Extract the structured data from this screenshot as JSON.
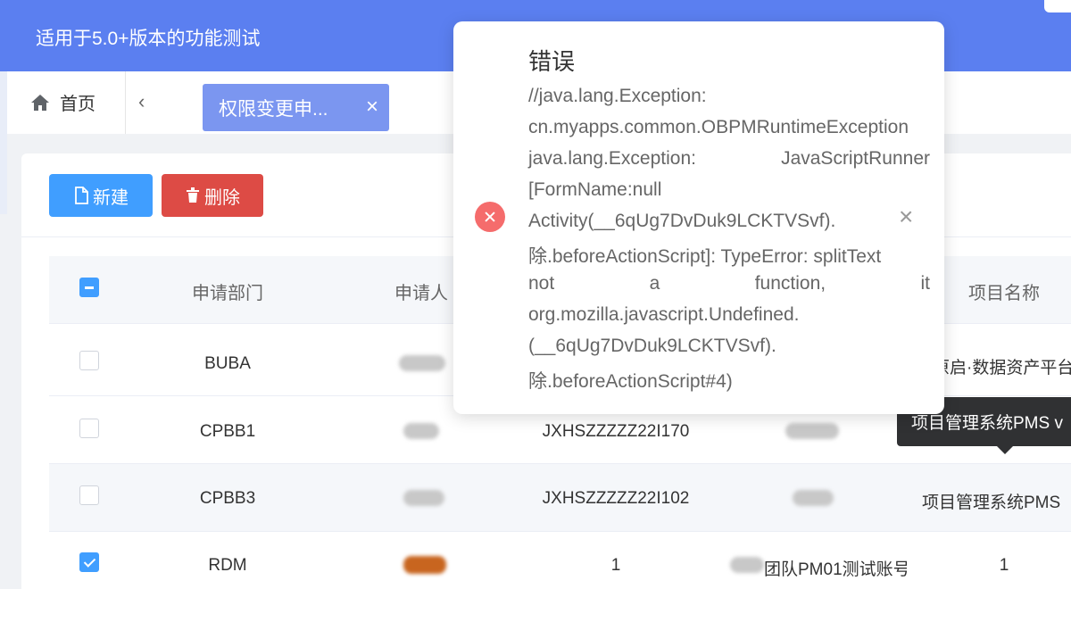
{
  "header": {
    "title": "适用于5.0+版本的功能测试"
  },
  "tabs": {
    "home_label": "首页",
    "prev_label": "‹",
    "active_label": "权限变更申...",
    "close_label": "×"
  },
  "toolbar": {
    "new_label": "新建",
    "delete_label": "删除"
  },
  "table": {
    "headers": [
      "申请部门",
      "申请人",
      "项目名称"
    ],
    "rows": [
      {
        "dept": "BUBA",
        "code": "",
        "num": "",
        "project": "原启·数据资产平台",
        "checked": false
      },
      {
        "dept": "CPBB1",
        "code": "JXHSZZZZZ22I170",
        "num": "",
        "project": "",
        "checked": false
      },
      {
        "dept": "CPBB3",
        "code": "JXHSZZZZZ22I102",
        "num": "",
        "project": "项目管理系统PMS",
        "checked": false
      },
      {
        "dept": "RDM",
        "code": "1",
        "num": "团队PM01测试账号",
        "project": "1",
        "checked": true
      }
    ]
  },
  "tooltip": {
    "text": "项目管理系统PMS v"
  },
  "dialog": {
    "title": "错误",
    "lines": [
      "//java.lang.Exception:",
      "cn.myapps.common.OBPMRuntimeException",
      [
        "java.lang.Exception:",
        "JavaScriptRunner"
      ],
      "[FormName:null",
      "Activity(__6qUg7DvDuk9LCKTVSvf).",
      "除.beforeActionScript]: TypeError: splitText",
      [
        "not",
        "a",
        "function,",
        "it"
      ],
      "org.mozilla.javascript.Undefined.",
      "(__6qUg7DvDuk9LCKTVSvf).",
      "除.beforeActionScript#4)"
    ],
    "close_label": "×"
  },
  "colors": {
    "header": "#5b7ff0",
    "primary": "#409eff",
    "danger": "#dd4b45",
    "error_icon": "#f56c6c"
  },
  "icons": [
    "home-icon",
    "file-icon",
    "trash-icon",
    "error-icon",
    "close-icon"
  ]
}
